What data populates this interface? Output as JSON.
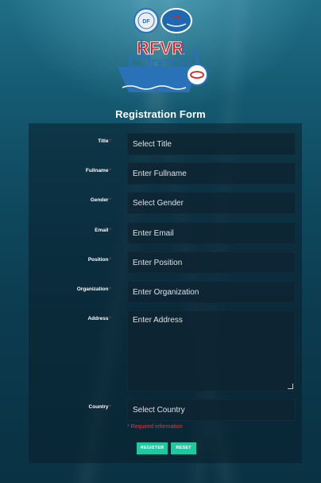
{
  "logo": {
    "text": "RFVR",
    "badge_left": "Fisheries",
    "badge_right": "JTF"
  },
  "form_title": "Registration Form",
  "required_marker": "*",
  "fields": [
    {
      "label": "Title",
      "placeholder": "Select Title"
    },
    {
      "label": "Fullname",
      "placeholder": "Enter Fullname"
    },
    {
      "label": "Gender",
      "placeholder": "Select Gender"
    },
    {
      "label": "Email",
      "placeholder": "Enter Email"
    },
    {
      "label": "Position",
      "placeholder": "Enter Position"
    },
    {
      "label": "Organization",
      "placeholder": "Enter Organization"
    },
    {
      "label": "Address",
      "placeholder": "Enter Address"
    },
    {
      "label": "Country",
      "placeholder": "Select Country"
    }
  ],
  "required_note": "* Required information",
  "buttons": {
    "register": "REGISTER",
    "reset": "RESET"
  },
  "colors": {
    "accent": "#1ec9a2",
    "required": "#e23b3b",
    "logo_red": "#e02020",
    "logo_blue": "#2a72b8"
  }
}
